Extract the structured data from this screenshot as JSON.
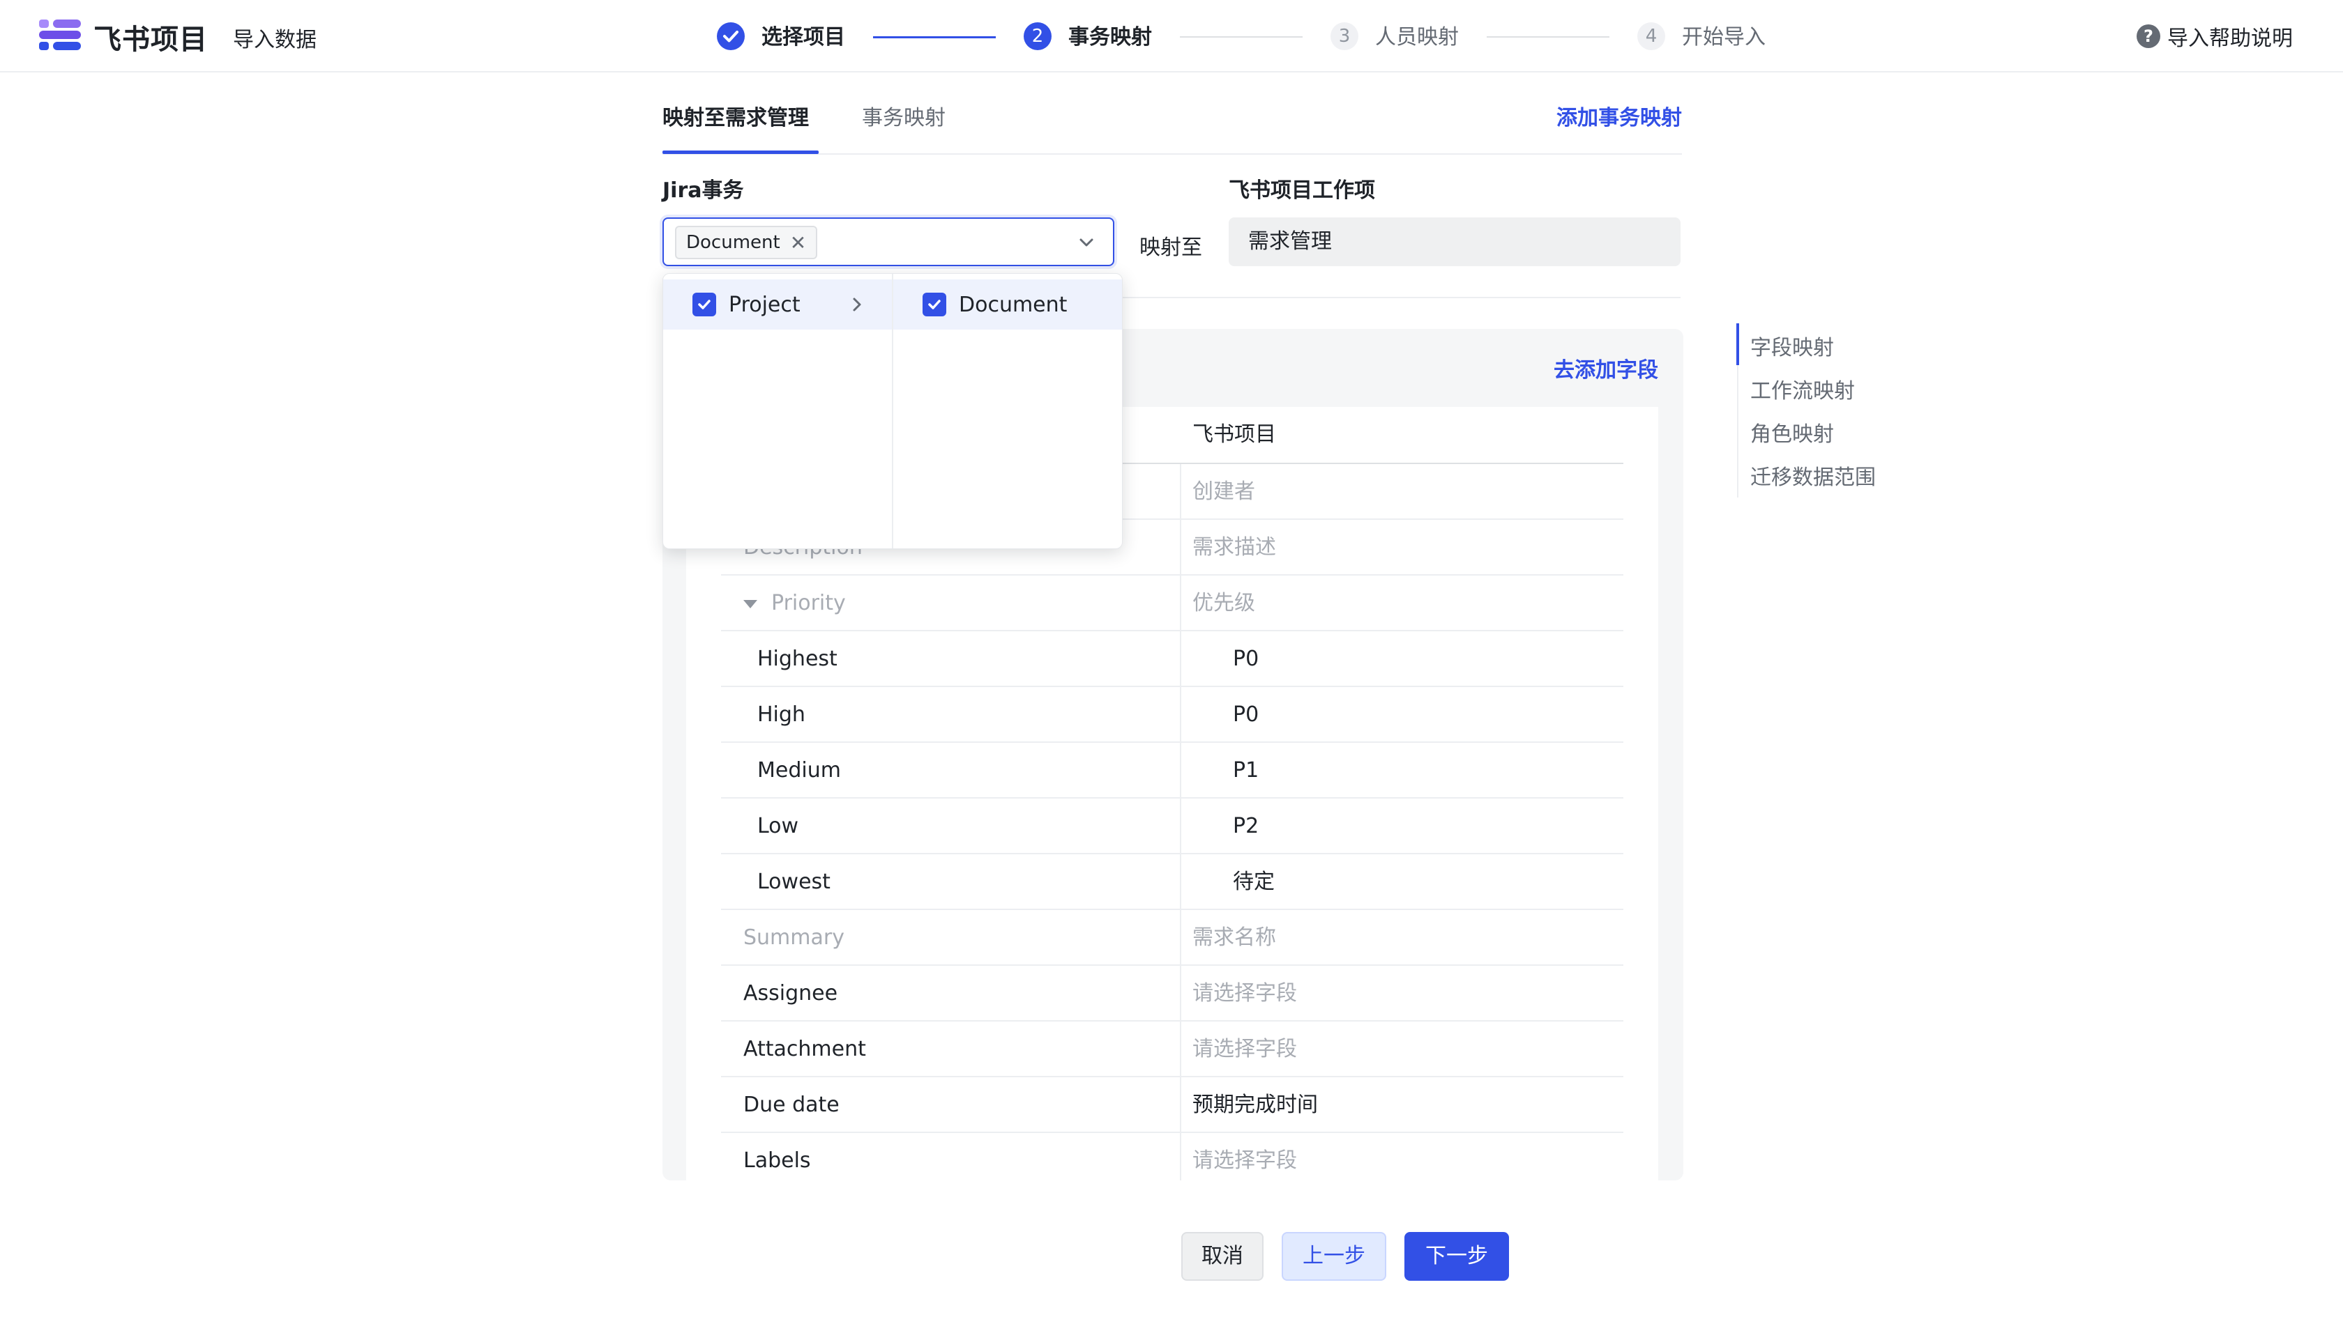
{
  "header": {
    "app_title": "飞书项目",
    "page_subtitle": "导入数据",
    "help_label": "导入帮助说明",
    "help_icon": "question-circle-icon"
  },
  "steps": [
    {
      "number": "1",
      "label": "选择项目",
      "status": "done"
    },
    {
      "number": "2",
      "label": "事务映射",
      "status": "active"
    },
    {
      "number": "3",
      "label": "人员映射",
      "status": "todo"
    },
    {
      "number": "4",
      "label": "开始导入",
      "status": "todo"
    }
  ],
  "tabs": {
    "active": "映射至需求管理",
    "inactive": "事务映射",
    "add_link": "添加事务映射"
  },
  "mapping": {
    "jira_label": "Jira事务",
    "feishu_label": "飞书项目工作项",
    "selected_tag": "Document",
    "maps_to": "映射至",
    "feishu_value": "需求管理"
  },
  "dropdown": {
    "left_item": "Project",
    "right_item": "Document"
  },
  "card": {
    "add_field_link": "去添加字段",
    "header_feishu": "飞书项目",
    "rows": [
      {
        "left": "",
        "right": "创建者",
        "left_style": "muted",
        "right_style": "muted"
      },
      {
        "left": "Description",
        "right": "需求描述",
        "left_style": "muted",
        "right_style": "muted"
      },
      {
        "left": "Priority",
        "right": "优先级",
        "left_style": "muted",
        "right_style": "muted",
        "expandable": true
      },
      {
        "left": "Highest",
        "right": "P0",
        "left_style": "dark",
        "right_style": "dark",
        "child": true
      },
      {
        "left": "High",
        "right": "P0",
        "left_style": "dark",
        "right_style": "dark",
        "child": true
      },
      {
        "left": "Medium",
        "right": "P1",
        "left_style": "dark",
        "right_style": "dark",
        "child": true
      },
      {
        "left": "Low",
        "right": "P2",
        "left_style": "dark",
        "right_style": "dark",
        "child": true
      },
      {
        "left": "Lowest",
        "right": "待定",
        "left_style": "dark",
        "right_style": "dark",
        "child": true
      },
      {
        "left": "Summary",
        "right": "需求名称",
        "left_style": "muted",
        "right_style": "muted"
      },
      {
        "left": "Assignee",
        "right": "请选择字段",
        "left_style": "dark",
        "right_style": "muted"
      },
      {
        "left": "Attachment",
        "right": "请选择字段",
        "left_style": "dark",
        "right_style": "muted"
      },
      {
        "left": "Due date",
        "right": "预期完成时间",
        "left_style": "dark",
        "right_style": "dark"
      },
      {
        "left": "Labels",
        "right": "请选择字段",
        "left_style": "dark",
        "right_style": "muted"
      }
    ]
  },
  "side_nav": [
    "字段映射",
    "工作流映射",
    "角色映射",
    "迁移数据范围"
  ],
  "footer": {
    "cancel": "取消",
    "prev": "上一步",
    "next": "下一步"
  },
  "colors": {
    "accent": "#3250e6",
    "brand_purple": "#8b6cf0"
  }
}
